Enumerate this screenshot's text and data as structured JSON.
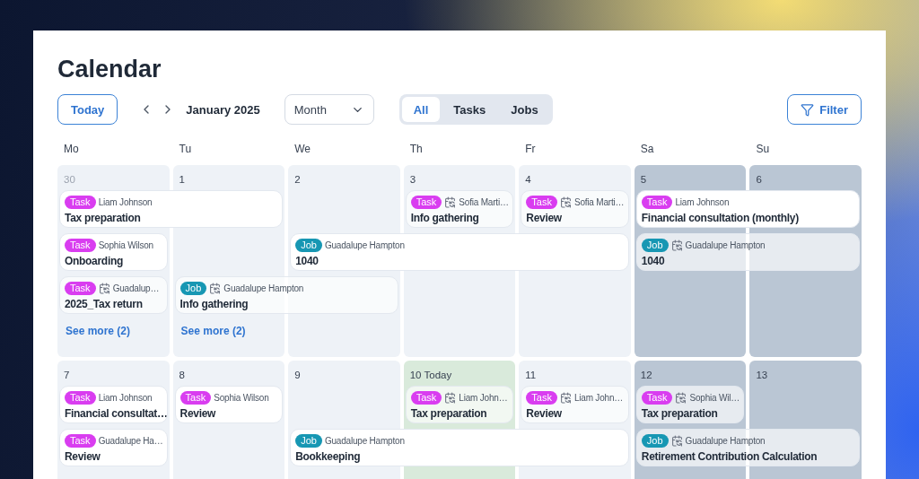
{
  "title": "Calendar",
  "toolbar": {
    "today_button": "Today",
    "period": "January 2025",
    "view": "Month",
    "filter_button": "Filter",
    "filters": [
      {
        "label": "All",
        "selected": true
      },
      {
        "label": "Tasks",
        "selected": false
      },
      {
        "label": "Jobs",
        "selected": false
      }
    ]
  },
  "weekdays": [
    "Mo",
    "Tu",
    "We",
    "Th",
    "Fr",
    "Sa",
    "Su"
  ],
  "weeks": [
    {
      "days": [
        {
          "label": "30",
          "outside_month": true,
          "weekend": false,
          "today": false,
          "see_more": "See more (2)"
        },
        {
          "label": "1",
          "outside_month": false,
          "weekend": false,
          "today": false,
          "see_more": "See more (2)"
        },
        {
          "label": "2",
          "outside_month": false,
          "weekend": false,
          "today": false
        },
        {
          "label": "3",
          "outside_month": false,
          "weekend": false,
          "today": false
        },
        {
          "label": "4",
          "outside_month": false,
          "weekend": false,
          "today": false
        },
        {
          "label": "5",
          "outside_month": false,
          "weekend": true,
          "today": false
        },
        {
          "label": "6",
          "outside_month": false,
          "weekend": true,
          "today": false
        }
      ],
      "lanes": [
        [
          {
            "kind": "task",
            "badge": "Task",
            "person": "Liam Johnson",
            "title": "Tax preparation",
            "recurring": false
          },
          {
            "kind": "continuation"
          },
          {
            "kind": "empty"
          },
          {
            "kind": "task",
            "badge": "Task",
            "person": "Sofia Marti…",
            "title": "Info gathering",
            "recurring": true
          },
          {
            "kind": "task",
            "badge": "Task",
            "person": "Sofia Marti…",
            "title": "Review",
            "recurring": true
          },
          {
            "kind": "task",
            "badge": "Task",
            "person": "Liam Johnson",
            "title": "Financial consultation (monthly)",
            "recurring": false
          },
          {
            "kind": "continuation"
          }
        ],
        [
          {
            "kind": "task",
            "badge": "Task",
            "person": "Sophia Wilson",
            "title": "Onboarding",
            "recurring": false
          },
          {
            "kind": "empty"
          },
          {
            "kind": "job",
            "badge": "Job",
            "person": "Guadalupe Hampton",
            "title": "1040",
            "recurring": false
          },
          {
            "kind": "continuation"
          },
          {
            "kind": "continuation"
          },
          {
            "kind": "job",
            "badge": "Job",
            "person": "Guadalupe Hampton",
            "title": "1040",
            "recurring": true
          },
          {
            "kind": "continuation"
          }
        ],
        [
          {
            "kind": "task",
            "badge": "Task",
            "person": "Guadalup…",
            "title": "2025_Tax return",
            "recurring": true
          },
          {
            "kind": "job",
            "badge": "Job",
            "person": "Guadalupe Hampton",
            "title": "Info gathering",
            "recurring": true
          },
          {
            "kind": "continuation"
          }
        ]
      ]
    },
    {
      "days": [
        {
          "label": "7",
          "outside_month": false,
          "weekend": false,
          "today": false
        },
        {
          "label": "8",
          "outside_month": false,
          "weekend": false,
          "today": false
        },
        {
          "label": "9",
          "outside_month": false,
          "weekend": false,
          "today": false
        },
        {
          "label": "10 Today",
          "outside_month": false,
          "weekend": false,
          "today": true
        },
        {
          "label": "11",
          "outside_month": false,
          "weekend": false,
          "today": false
        },
        {
          "label": "12",
          "outside_month": false,
          "weekend": true,
          "today": false
        },
        {
          "label": "13",
          "outside_month": false,
          "weekend": true,
          "today": false
        }
      ],
      "lanes": [
        [
          {
            "kind": "task",
            "badge": "Task",
            "person": "Liam Johnson",
            "title": "Financial consultat…",
            "recurring": false
          },
          {
            "kind": "task",
            "badge": "Task",
            "person": "Sophia Wilson",
            "title": "Review",
            "recurring": false
          },
          {
            "kind": "empty"
          },
          {
            "kind": "task",
            "badge": "Task",
            "person": "Liam John…",
            "title": "Tax preparation",
            "recurring": true
          },
          {
            "kind": "task",
            "badge": "Task",
            "person": "Liam John…",
            "title": "Review",
            "recurring": true
          },
          {
            "kind": "task",
            "badge": "Task",
            "person": "Sophia Wil…",
            "title": "Tax preparation",
            "recurring": true
          }
        ],
        [
          {
            "kind": "task",
            "badge": "Task",
            "person": "Guadalupe Ha…",
            "title": "Review",
            "recurring": false
          },
          {
            "kind": "empty"
          },
          {
            "kind": "job",
            "badge": "Job",
            "person": "Guadalupe Hampton",
            "title": "Bookkeeping",
            "recurring": false
          },
          {
            "kind": "continuation"
          },
          {
            "kind": "continuation"
          },
          {
            "kind": "job",
            "badge": "Job",
            "person": "Guadalupe Hampton",
            "title": "Retirement Contribution Calculation",
            "recurring": true
          },
          {
            "kind": "continuation"
          }
        ]
      ]
    }
  ]
}
